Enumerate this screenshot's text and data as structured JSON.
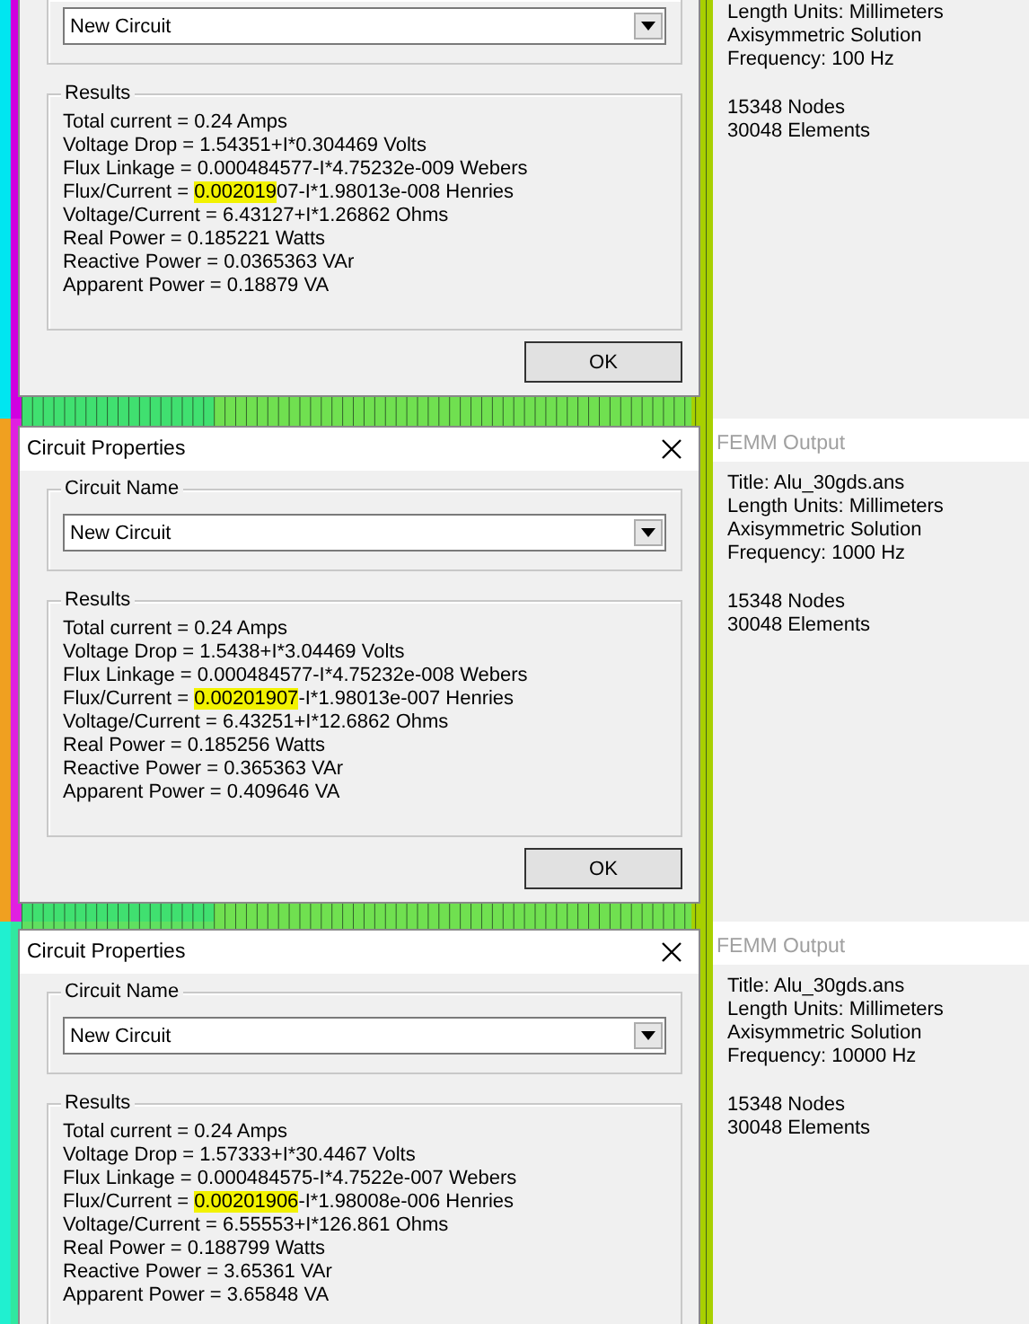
{
  "panels": [
    {
      "dialog": {
        "circuit_name": "New Circuit",
        "results_label": "Results",
        "ok": "OK",
        "results": [
          {
            "parts": [
              {
                "text": "Total current = 0.24 Amps",
                "highlighted": false
              }
            ]
          },
          {
            "parts": [
              {
                "text": "Voltage Drop = 1.54351+I*0.304469 Volts",
                "highlighted": false
              }
            ]
          },
          {
            "parts": [
              {
                "text": "Flux Linkage = 0.000484577-I*4.75232e-009 Webers",
                "highlighted": false
              }
            ]
          },
          {
            "parts": [
              {
                "text": "Flux/Current = ",
                "highlighted": false
              },
              {
                "text": "0.002019",
                "highlighted": true
              },
              {
                "text": "07-I*1.98013e-008 Henries",
                "highlighted": false
              }
            ]
          },
          {
            "parts": [
              {
                "text": "Voltage/Current = 6.43127+I*1.26862 Ohms",
                "highlighted": false
              }
            ]
          },
          {
            "parts": [
              {
                "text": "Real Power = 0.185221 Watts",
                "highlighted": false
              }
            ]
          },
          {
            "parts": [
              {
                "text": "Reactive Power = 0.0365363 VAr",
                "highlighted": false
              }
            ]
          },
          {
            "parts": [
              {
                "text": "Apparent Power = 0.18879 VA",
                "highlighted": false
              }
            ]
          }
        ]
      },
      "output": {
        "groups": [
          [
            "Length Units: Millimeters",
            "Axisymmetric Solution",
            "Frequency:  100 Hz"
          ],
          [
            "15348 Nodes",
            "30048 Elements"
          ]
        ]
      }
    },
    {
      "dialog": {
        "title": "Circuit Properties",
        "circuit_name_label": "Circuit Name",
        "circuit_name": "New Circuit",
        "results_label": "Results",
        "ok": "OK",
        "results": [
          {
            "parts": [
              {
                "text": "Total current = 0.24 Amps",
                "highlighted": false
              }
            ]
          },
          {
            "parts": [
              {
                "text": "Voltage Drop = 1.5438+I*3.04469 Volts",
                "highlighted": false
              }
            ]
          },
          {
            "parts": [
              {
                "text": "Flux Linkage = 0.000484577-I*4.75232e-008 Webers",
                "highlighted": false
              }
            ]
          },
          {
            "parts": [
              {
                "text": "Flux/Current = ",
                "highlighted": false
              },
              {
                "text": "0.00201907",
                "highlighted": true
              },
              {
                "text": "-I*1.98013e-007 Henries",
                "highlighted": false
              }
            ]
          },
          {
            "parts": [
              {
                "text": "Voltage/Current = 6.43251+I*12.6862 Ohms",
                "highlighted": false
              }
            ]
          },
          {
            "parts": [
              {
                "text": "Real Power = 0.185256 Watts",
                "highlighted": false
              }
            ]
          },
          {
            "parts": [
              {
                "text": "Reactive Power = 0.365363 VAr",
                "highlighted": false
              }
            ]
          },
          {
            "parts": [
              {
                "text": "Apparent Power = 0.409646 VA",
                "highlighted": false
              }
            ]
          }
        ]
      },
      "output": {
        "title": "FEMM Output",
        "groups": [
          [
            "Title: Alu_30gds.ans",
            "Length Units: Millimeters",
            "Axisymmetric Solution",
            "Frequency:  1000 Hz"
          ],
          [
            "15348 Nodes",
            "30048 Elements"
          ]
        ]
      }
    },
    {
      "dialog": {
        "title": "Circuit Properties",
        "circuit_name_label": "Circuit Name",
        "circuit_name": "New Circuit",
        "results_label": "Results",
        "results": [
          {
            "parts": [
              {
                "text": "Total current = 0.24 Amps",
                "highlighted": false
              }
            ]
          },
          {
            "parts": [
              {
                "text": "Voltage Drop = 1.57333+I*30.4467 Volts",
                "highlighted": false
              }
            ]
          },
          {
            "parts": [
              {
                "text": "Flux Linkage = 0.000484575-I*4.7522e-007 Webers",
                "highlighted": false
              }
            ]
          },
          {
            "parts": [
              {
                "text": "Flux/Current = ",
                "highlighted": false
              },
              {
                "text": "0.00201906",
                "highlighted": true
              },
              {
                "text": "-I*1.98008e-006 Henries",
                "highlighted": false
              }
            ]
          },
          {
            "parts": [
              {
                "text": "Voltage/Current = 6.55553+I*126.861 Ohms",
                "highlighted": false
              }
            ]
          },
          {
            "parts": [
              {
                "text": "Real Power = 0.188799 Watts",
                "highlighted": false
              }
            ]
          },
          {
            "parts": [
              {
                "text": "Reactive Power = 3.65361 VAr",
                "highlighted": false
              }
            ]
          },
          {
            "parts": [
              {
                "text": "Apparent Power = 3.65848 VA",
                "highlighted": false
              }
            ]
          }
        ]
      },
      "output": {
        "title": "FEMM Output",
        "groups": [
          [
            "Title: Alu_30gds.ans",
            "Length Units: Millimeters",
            "Axisymmetric Solution",
            "Frequency:  10000 Hz"
          ],
          [
            "15348 Nodes",
            "30048 Elements"
          ]
        ]
      }
    }
  ]
}
